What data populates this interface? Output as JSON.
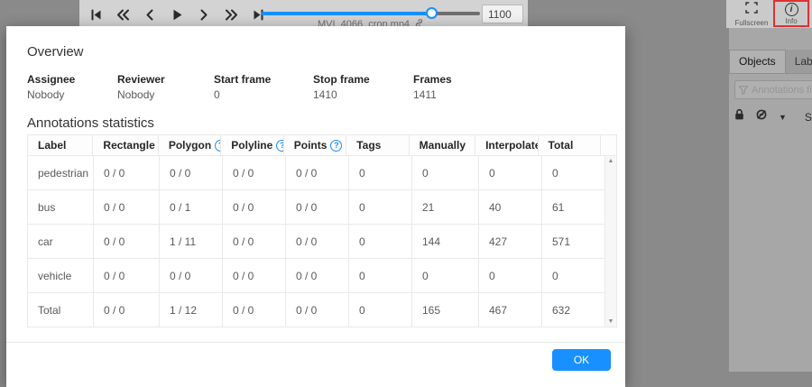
{
  "colors": {
    "accent": "#1890ff",
    "highlight_red": "#e03131",
    "dim_background": "#8a8a8a",
    "topbar_background": "#d3d3d3",
    "modal_background": "#ffffff"
  },
  "icons": {
    "player": [
      "skip-first",
      "jump-backward",
      "previous-frame",
      "play",
      "next-frame",
      "jump-forward",
      "skip-last"
    ],
    "topbar": [
      "fullscreen-icon",
      "info-icon"
    ],
    "filename": "link-icon",
    "sidebar": [
      "filter-funnel-icon",
      "lock-icon",
      "hide-eye-icon",
      "caret-down-icon"
    ],
    "table_header_help": "question-circle-icon",
    "table_scrollbar": [
      "scroll-up-arrow",
      "scroll-down-arrow"
    ]
  },
  "player": {
    "filename": "MVI_4066_crop.mp4",
    "frame_value": "1100",
    "slider_percent": 78
  },
  "topbar": {
    "fullscreen_label": "Fullscreen",
    "info_label": "Info"
  },
  "sidebar": {
    "tabs": [
      {
        "label": "Objects",
        "active": true
      },
      {
        "label": "Labels",
        "active": false
      }
    ],
    "filter_placeholder": "Annotations filter",
    "sort_label": "So"
  },
  "modal": {
    "overview_title": "Overview",
    "fields": [
      {
        "label": "Assignee",
        "value": "Nobody"
      },
      {
        "label": "Reviewer",
        "value": "Nobody"
      },
      {
        "label": "Start frame",
        "value": "0"
      },
      {
        "label": "Stop frame",
        "value": "1410"
      },
      {
        "label": "Frames",
        "value": "1411"
      }
    ],
    "stats_title": "Annotations statistics",
    "table": {
      "columns": [
        {
          "label": "Label",
          "help": false
        },
        {
          "label": "Rectangle",
          "help": true
        },
        {
          "label": "Polygon",
          "help": true
        },
        {
          "label": "Polyline",
          "help": true
        },
        {
          "label": "Points",
          "help": true
        },
        {
          "label": "Tags",
          "help": false
        },
        {
          "label": "Manually",
          "help": false
        },
        {
          "label": "Interpolated",
          "help": false
        },
        {
          "label": "Total",
          "help": false
        }
      ],
      "rows": [
        {
          "label": "pedestrian",
          "cells": [
            "0 / 0",
            "0 / 0",
            "0 / 0",
            "0 / 0",
            "0",
            "0",
            "0",
            "0"
          ]
        },
        {
          "label": "bus",
          "cells": [
            "0 / 0",
            "0 / 1",
            "0 / 0",
            "0 / 0",
            "0",
            "21",
            "40",
            "61"
          ]
        },
        {
          "label": "car",
          "cells": [
            "0 / 0",
            "1 / 11",
            "0 / 0",
            "0 / 0",
            "0",
            "144",
            "427",
            "571"
          ]
        },
        {
          "label": "vehicle",
          "cells": [
            "0 / 0",
            "0 / 0",
            "0 / 0",
            "0 / 0",
            "0",
            "0",
            "0",
            "0"
          ]
        },
        {
          "label": "Total",
          "cells": [
            "0 / 0",
            "1 / 12",
            "0 / 0",
            "0 / 0",
            "0",
            "165",
            "467",
            "632"
          ]
        }
      ]
    },
    "ok_label": "OK"
  }
}
